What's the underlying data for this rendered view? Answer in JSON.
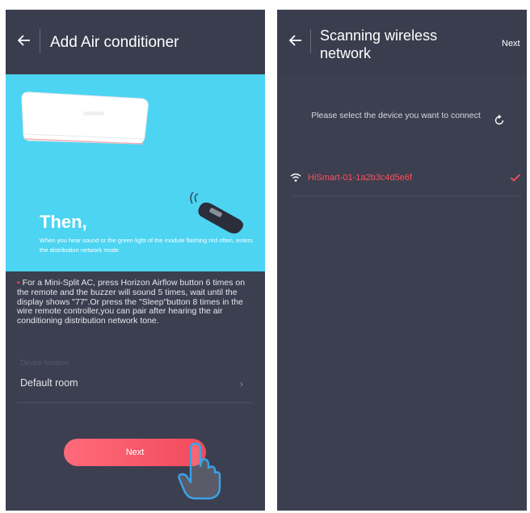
{
  "left_screen": {
    "header": {
      "title": "Add Air conditioner"
    },
    "hero": {
      "heading": "Then,",
      "subtitle": "When you hear sound or the green light of the module flashing red often, enters the distribution network mode."
    },
    "instruction": "For a Mini-Split AC, press Horizon Airflow button 6 times on the remote and the buzzer will sound 5 times, wait until the display shows \"77\".Or press the \"Sleep\"button 8 times in the wire remote controller,you can pair after hearing the air conditioning distribution network tone.",
    "location_label": "Device location",
    "room": {
      "value": "Default room",
      "chevron": "›"
    },
    "next_button": {
      "label": "Next"
    }
  },
  "right_screen": {
    "header": {
      "title_line1": "Scanning wireless",
      "title_line2": "network",
      "next_label": "Next"
    },
    "prompt": "Please select the device you want to connect",
    "devices": [
      {
        "name": "HiSmart-01-1a2b3c4d5e6f",
        "selected": true,
        "icon": "wifi-icon"
      }
    ]
  },
  "colors": {
    "header": "#3a3d4d",
    "background": "#3c3f4f",
    "hero": "#4cd4f2",
    "accent": "#ff4e5f"
  }
}
